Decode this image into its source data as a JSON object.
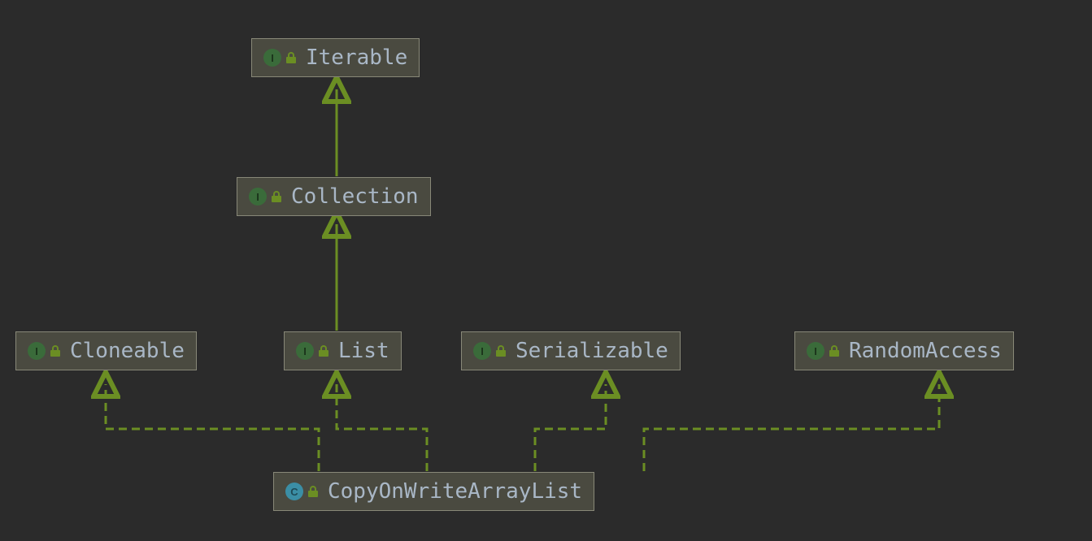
{
  "nodes": {
    "iterable": {
      "label": "Iterable",
      "kind": "interface"
    },
    "collection": {
      "label": "Collection",
      "kind": "interface"
    },
    "cloneable": {
      "label": "Cloneable",
      "kind": "interface"
    },
    "list": {
      "label": "List",
      "kind": "interface"
    },
    "serializable": {
      "label": "Serializable",
      "kind": "interface"
    },
    "randomaccess": {
      "label": "RandomAccess",
      "kind": "interface"
    },
    "copyonwritearraylist": {
      "label": "CopyOnWriteArrayList",
      "kind": "class"
    }
  },
  "icon_letters": {
    "interface": "I",
    "class": "C"
  },
  "edges": [
    {
      "from": "collection",
      "to": "iterable",
      "style": "solid"
    },
    {
      "from": "list",
      "to": "collection",
      "style": "solid"
    },
    {
      "from": "copyonwritearraylist",
      "to": "cloneable",
      "style": "dashed"
    },
    {
      "from": "copyonwritearraylist",
      "to": "list",
      "style": "dashed"
    },
    {
      "from": "copyonwritearraylist",
      "to": "serializable",
      "style": "dashed"
    },
    {
      "from": "copyonwritearraylist",
      "to": "randomaccess",
      "style": "dashed"
    }
  ],
  "colors": {
    "background": "#2b2b2b",
    "node_fill": "#4a4a40",
    "node_border": "#888878",
    "text": "#a9b7c6",
    "arrow": "#6b8e23",
    "interface_icon": "#3a6b3a",
    "class_icon": "#3b8ea5"
  }
}
